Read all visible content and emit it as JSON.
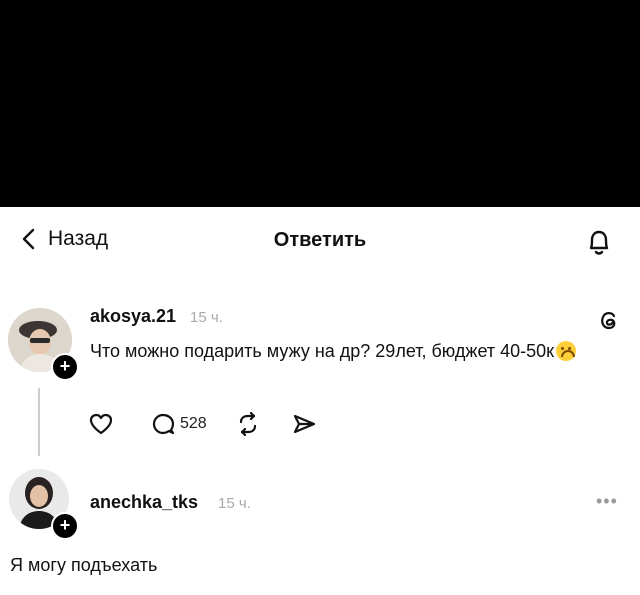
{
  "header": {
    "back_label": "Назад",
    "title": "Ответить"
  },
  "post": {
    "username": "akosya.21",
    "time": "15 ч.",
    "text": "Что можно подарить мужу на др? 29лет, бюджет 40-50к",
    "reply_count": "528"
  },
  "reply": {
    "username": "anechka_tks",
    "time": "15 ч.",
    "text": "Я могу подъехать"
  },
  "icons": {
    "back": "chevron-left-icon",
    "bell": "bell-icon",
    "threads": "threads-logo-icon",
    "like": "heart-icon",
    "comment": "comment-icon",
    "repost": "repost-icon",
    "share": "send-icon",
    "more": "more-icon",
    "emoji": "upside-down-face-icon"
  }
}
